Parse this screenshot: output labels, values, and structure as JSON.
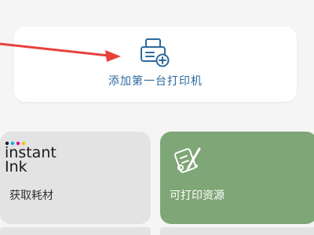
{
  "add_printer": {
    "label": "添加第一台打印机",
    "icon": "printer-add-icon"
  },
  "tiles": [
    {
      "label": "获取耗材",
      "logo_text_line1": "instant",
      "logo_text_line2": "Ink",
      "icon": "instant-ink-logo",
      "bg_color": "#e3e3e3"
    },
    {
      "label": "可打印资源",
      "icon": "printables-icon",
      "bg_color": "#7ea676"
    }
  ],
  "colors": {
    "accent_blue": "#2c6a9e",
    "arrow_red": "#e8413c",
    "background": "#f5f5f5"
  }
}
